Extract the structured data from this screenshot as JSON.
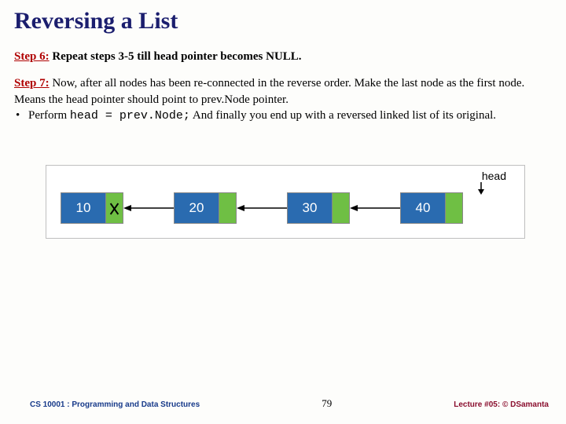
{
  "title": "Reversing a List",
  "step6": {
    "label": "Step 6:",
    "text": " Repeat steps 3-5 till head pointer becomes NULL."
  },
  "step7": {
    "label": "Step 7:",
    "text1": " Now, after all nodes has been re-connected in the reverse order. Make the last node as the first node. Means the head pointer should point to prev.Node pointer.",
    "bullet_lead": "Perform ",
    "code": "head = prev.Node;",
    "bullet_tail": "  And finally you end up with a reversed linked list of its original."
  },
  "diagram": {
    "head_label": "head",
    "nodes": [
      "10",
      "20",
      "30",
      "40"
    ]
  },
  "footer": {
    "left": "CS 10001 : Programming and Data Structures",
    "center": "79",
    "right": "Lecture #05: © DSamanta"
  }
}
